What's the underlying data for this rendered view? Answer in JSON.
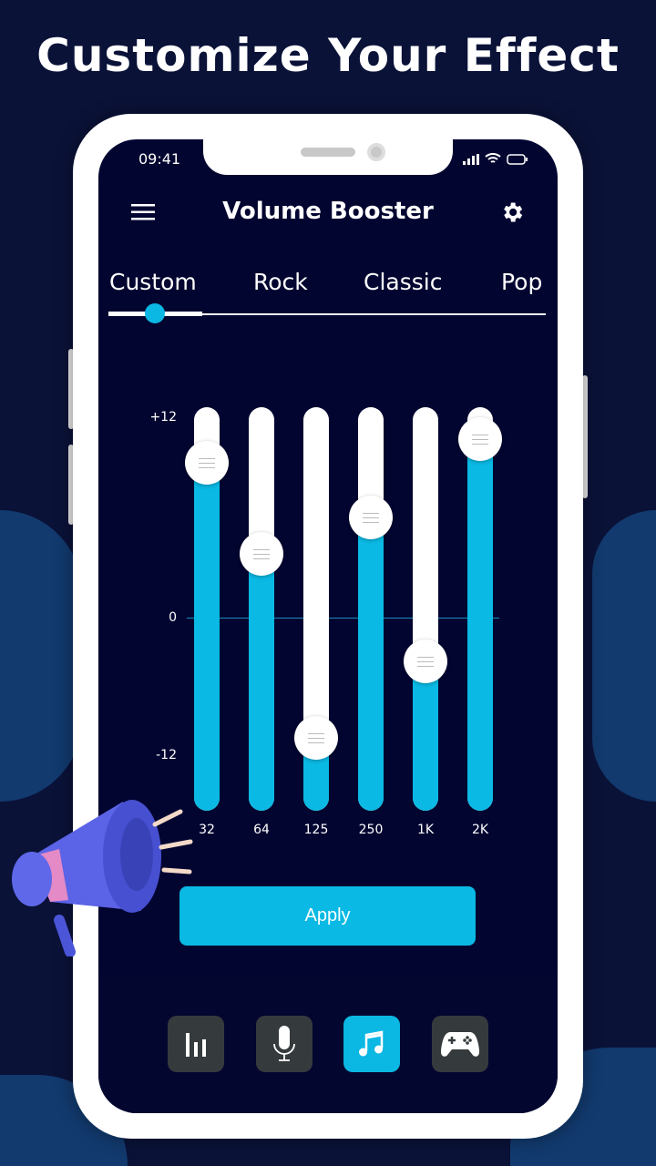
{
  "headline": "Customize Your Effect",
  "status": {
    "time": "09:41"
  },
  "app": {
    "title": "Volume Booster",
    "menu_icon": "hamburger-icon",
    "settings_icon": "gear-icon"
  },
  "tabs": [
    {
      "label": "Custom",
      "selected": true
    },
    {
      "label": "Rock"
    },
    {
      "label": "Classic"
    },
    {
      "label": "Pop"
    }
  ],
  "equalizer": {
    "y_labels": {
      "top": "+12",
      "mid": "0",
      "bottom": "-12"
    },
    "bands": [
      {
        "label": "32",
        "value_db": 9.3
      },
      {
        "label": "64",
        "value_db": 3.8
      },
      {
        "label": "125",
        "value_db": -7.2
      },
      {
        "label": "250",
        "value_db": 6
      },
      {
        "label": "1K",
        "value_db": -2.6
      },
      {
        "label": "2K",
        "value_db": 10.7
      }
    ]
  },
  "apply_label": "Apply",
  "bottom_nav": [
    {
      "icon": "equalizer-icon"
    },
    {
      "icon": "microphone-icon"
    },
    {
      "icon": "music-note-icon",
      "active": true
    },
    {
      "icon": "gamepad-icon"
    }
  ],
  "colors": {
    "accent": "#0ab9e4",
    "screen_bg": "#020530",
    "background": "#0a1238"
  }
}
